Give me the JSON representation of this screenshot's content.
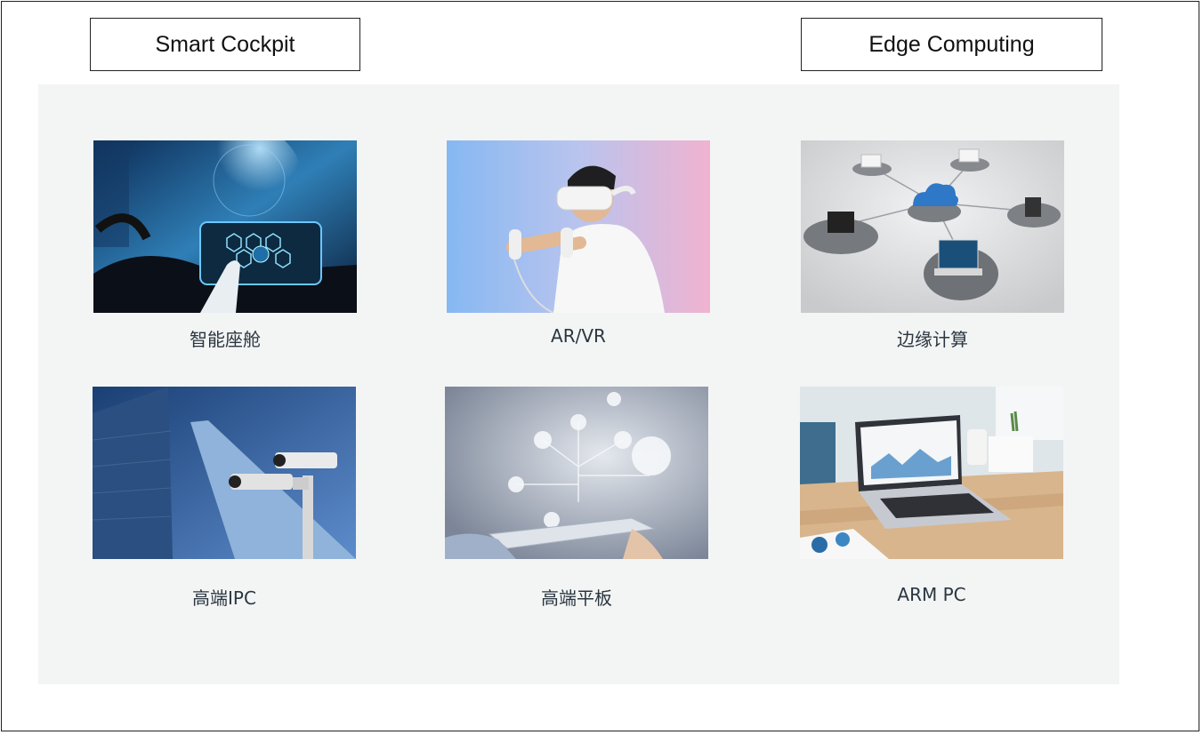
{
  "callouts": {
    "left": "Smart Cockpit",
    "right": "Edge Computing"
  },
  "cards": [
    {
      "label": "智能座舱",
      "icon": "smart-cockpit-image"
    },
    {
      "label": "AR/VR",
      "icon": "ar-vr-image"
    },
    {
      "label": "边缘计算",
      "icon": "edge-computing-image"
    },
    {
      "label": "高端IPC",
      "icon": "ipc-camera-image"
    },
    {
      "label": "高端平板",
      "icon": "tablet-image"
    },
    {
      "label": "ARM PC",
      "icon": "arm-pc-image"
    }
  ],
  "colors": {
    "panel_bg": "#f3f5f5",
    "label_text": "#2b3640"
  }
}
